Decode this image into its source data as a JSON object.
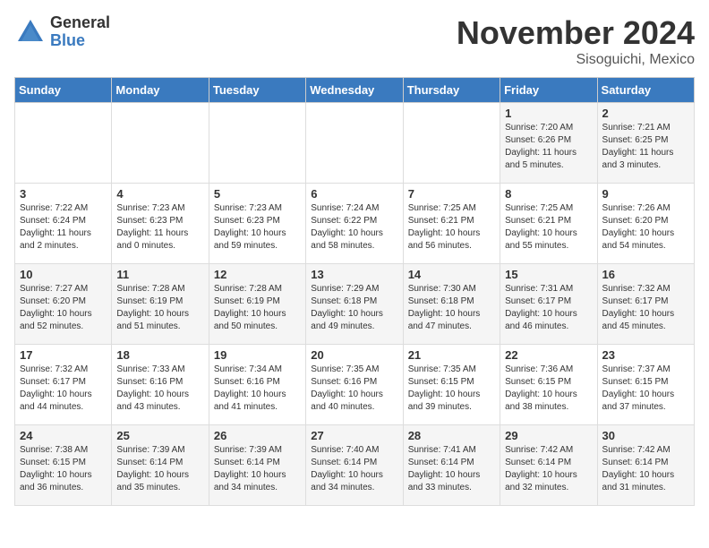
{
  "logo": {
    "general": "General",
    "blue": "Blue"
  },
  "title": "November 2024",
  "location": "Sisoguichi, Mexico",
  "days_header": [
    "Sunday",
    "Monday",
    "Tuesday",
    "Wednesday",
    "Thursday",
    "Friday",
    "Saturday"
  ],
  "weeks": [
    [
      {
        "day": "",
        "info": ""
      },
      {
        "day": "",
        "info": ""
      },
      {
        "day": "",
        "info": ""
      },
      {
        "day": "",
        "info": ""
      },
      {
        "day": "",
        "info": ""
      },
      {
        "day": "1",
        "info": "Sunrise: 7:20 AM\nSunset: 6:26 PM\nDaylight: 11 hours and 5 minutes."
      },
      {
        "day": "2",
        "info": "Sunrise: 7:21 AM\nSunset: 6:25 PM\nDaylight: 11 hours and 3 minutes."
      }
    ],
    [
      {
        "day": "3",
        "info": "Sunrise: 7:22 AM\nSunset: 6:24 PM\nDaylight: 11 hours and 2 minutes."
      },
      {
        "day": "4",
        "info": "Sunrise: 7:23 AM\nSunset: 6:23 PM\nDaylight: 11 hours and 0 minutes."
      },
      {
        "day": "5",
        "info": "Sunrise: 7:23 AM\nSunset: 6:23 PM\nDaylight: 10 hours and 59 minutes."
      },
      {
        "day": "6",
        "info": "Sunrise: 7:24 AM\nSunset: 6:22 PM\nDaylight: 10 hours and 58 minutes."
      },
      {
        "day": "7",
        "info": "Sunrise: 7:25 AM\nSunset: 6:21 PM\nDaylight: 10 hours and 56 minutes."
      },
      {
        "day": "8",
        "info": "Sunrise: 7:25 AM\nSunset: 6:21 PM\nDaylight: 10 hours and 55 minutes."
      },
      {
        "day": "9",
        "info": "Sunrise: 7:26 AM\nSunset: 6:20 PM\nDaylight: 10 hours and 54 minutes."
      }
    ],
    [
      {
        "day": "10",
        "info": "Sunrise: 7:27 AM\nSunset: 6:20 PM\nDaylight: 10 hours and 52 minutes."
      },
      {
        "day": "11",
        "info": "Sunrise: 7:28 AM\nSunset: 6:19 PM\nDaylight: 10 hours and 51 minutes."
      },
      {
        "day": "12",
        "info": "Sunrise: 7:28 AM\nSunset: 6:19 PM\nDaylight: 10 hours and 50 minutes."
      },
      {
        "day": "13",
        "info": "Sunrise: 7:29 AM\nSunset: 6:18 PM\nDaylight: 10 hours and 49 minutes."
      },
      {
        "day": "14",
        "info": "Sunrise: 7:30 AM\nSunset: 6:18 PM\nDaylight: 10 hours and 47 minutes."
      },
      {
        "day": "15",
        "info": "Sunrise: 7:31 AM\nSunset: 6:17 PM\nDaylight: 10 hours and 46 minutes."
      },
      {
        "day": "16",
        "info": "Sunrise: 7:32 AM\nSunset: 6:17 PM\nDaylight: 10 hours and 45 minutes."
      }
    ],
    [
      {
        "day": "17",
        "info": "Sunrise: 7:32 AM\nSunset: 6:17 PM\nDaylight: 10 hours and 44 minutes."
      },
      {
        "day": "18",
        "info": "Sunrise: 7:33 AM\nSunset: 6:16 PM\nDaylight: 10 hours and 43 minutes."
      },
      {
        "day": "19",
        "info": "Sunrise: 7:34 AM\nSunset: 6:16 PM\nDaylight: 10 hours and 41 minutes."
      },
      {
        "day": "20",
        "info": "Sunrise: 7:35 AM\nSunset: 6:16 PM\nDaylight: 10 hours and 40 minutes."
      },
      {
        "day": "21",
        "info": "Sunrise: 7:35 AM\nSunset: 6:15 PM\nDaylight: 10 hours and 39 minutes."
      },
      {
        "day": "22",
        "info": "Sunrise: 7:36 AM\nSunset: 6:15 PM\nDaylight: 10 hours and 38 minutes."
      },
      {
        "day": "23",
        "info": "Sunrise: 7:37 AM\nSunset: 6:15 PM\nDaylight: 10 hours and 37 minutes."
      }
    ],
    [
      {
        "day": "24",
        "info": "Sunrise: 7:38 AM\nSunset: 6:15 PM\nDaylight: 10 hours and 36 minutes."
      },
      {
        "day": "25",
        "info": "Sunrise: 7:39 AM\nSunset: 6:14 PM\nDaylight: 10 hours and 35 minutes."
      },
      {
        "day": "26",
        "info": "Sunrise: 7:39 AM\nSunset: 6:14 PM\nDaylight: 10 hours and 34 minutes."
      },
      {
        "day": "27",
        "info": "Sunrise: 7:40 AM\nSunset: 6:14 PM\nDaylight: 10 hours and 34 minutes."
      },
      {
        "day": "28",
        "info": "Sunrise: 7:41 AM\nSunset: 6:14 PM\nDaylight: 10 hours and 33 minutes."
      },
      {
        "day": "29",
        "info": "Sunrise: 7:42 AM\nSunset: 6:14 PM\nDaylight: 10 hours and 32 minutes."
      },
      {
        "day": "30",
        "info": "Sunrise: 7:42 AM\nSunset: 6:14 PM\nDaylight: 10 hours and 31 minutes."
      }
    ]
  ]
}
